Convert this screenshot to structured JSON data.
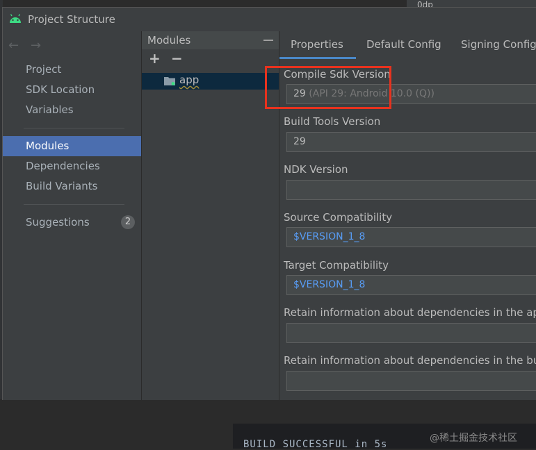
{
  "background": {
    "console_text": "BUILD SUCCESSFUL in 5s",
    "top_right_text": "0dp",
    "watermark": "@稀土掘金技术社区"
  },
  "dialog": {
    "title": "Project Structure"
  },
  "nav": {
    "items": [
      {
        "label": "Project"
      },
      {
        "label": "SDK Location"
      },
      {
        "label": "Variables"
      },
      {
        "label": "Modules",
        "selected": true
      },
      {
        "label": "Dependencies"
      },
      {
        "label": "Build Variants"
      },
      {
        "label": "Suggestions",
        "badge": "2"
      }
    ]
  },
  "modules": {
    "title": "Modules",
    "add": "+",
    "remove": "−",
    "items": [
      {
        "label": "app"
      }
    ]
  },
  "tabs": [
    {
      "label": "Properties",
      "active": true
    },
    {
      "label": "Default Config"
    },
    {
      "label": "Signing Configs"
    }
  ],
  "form": {
    "compile_sdk": {
      "label": "Compile Sdk Version",
      "value": "29",
      "hint": "(API 29: Android 10.0 (Q))"
    },
    "build_tools": {
      "label": "Build Tools Version",
      "value": "29"
    },
    "ndk": {
      "label": "NDK Version",
      "value": ""
    },
    "source_compat": {
      "label": "Source Compatibility",
      "value": "$VERSION_1_8"
    },
    "target_compat": {
      "label": "Target Compatibility",
      "value": "$VERSION_1_8"
    },
    "retain_apk": {
      "label": "Retain information about dependencies in the apk",
      "value": ""
    },
    "retain_bundle": {
      "label": "Retain information about dependencies in the bundle",
      "value": ""
    }
  },
  "colors": {
    "accent": "#4b6eaf",
    "highlight": "#e8321e",
    "link": "#589df6"
  }
}
